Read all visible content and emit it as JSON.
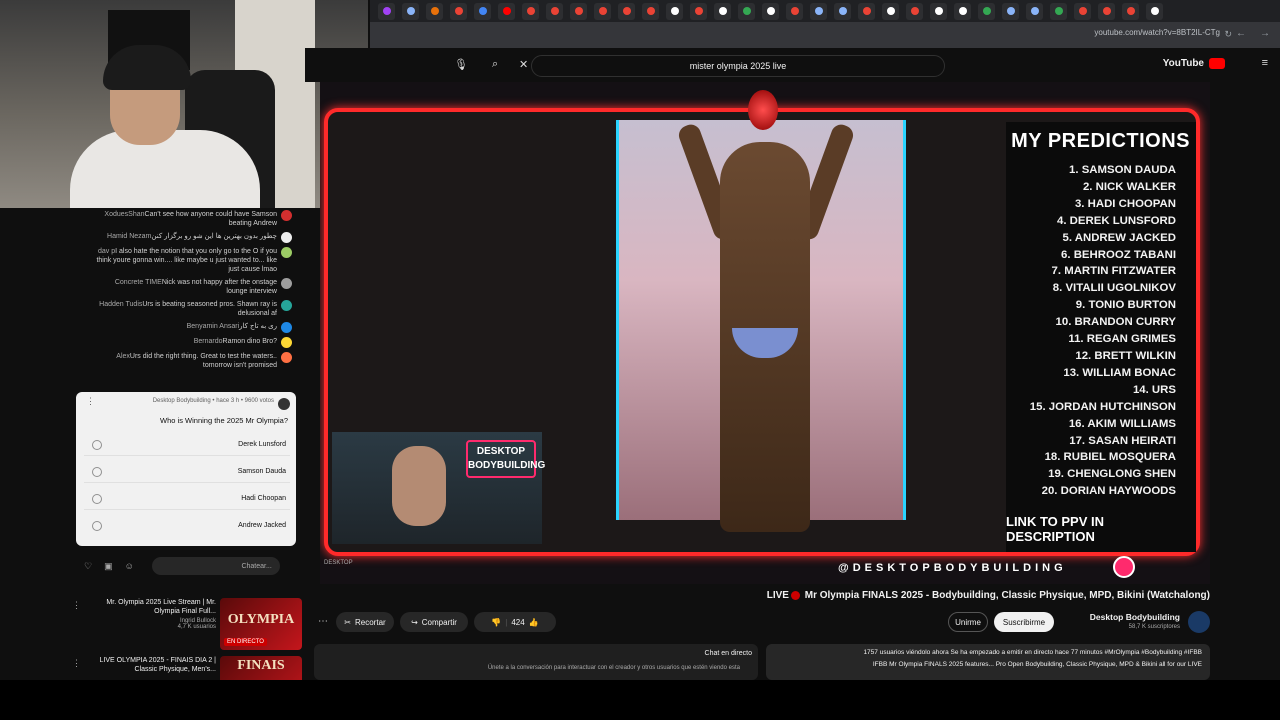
{
  "browser": {
    "url": "youtube.com/watch?v=8BT2IL-CTg",
    "tab_colors": [
      "#a142f4",
      "#8ab4f8",
      "#e8710a",
      "#ea4335",
      "#4285f4",
      "#ff0000",
      "#ea4335",
      "#ea4335",
      "#ea4335",
      "#ea4335",
      "#ea4335",
      "#ea4335",
      "#ffffff",
      "#ea4335",
      "#ffffff",
      "#34a853",
      "#ffffff",
      "#ea4335",
      "#8ab4f8",
      "#8ab4f8",
      "#ea4335",
      "#ffffff",
      "#ea4335",
      "#ffffff",
      "#ffffff",
      "#34a853",
      "#8ab4f8",
      "#8ab4f8",
      "#34a853",
      "#ea4335",
      "#ea4335",
      "#ea4335",
      "#ffffff"
    ]
  },
  "youtube": {
    "logo_text": "YouTube",
    "search_query": "mister olympia 2025 live"
  },
  "chat": {
    "messages": [
      {
        "author": "XoduesShan",
        "text": "Can't see how anyone could have Samson beating Andrew",
        "color": "#d32f2f"
      },
      {
        "author": "Hamid Nezam",
        "text": "چطور بدون بهترین ها این شو رو برگزار کنن",
        "color": "#eeeeee"
      },
      {
        "author": "dav p",
        "text": "I also hate the notion that you only go to the O if you think youre gonna win.... like maybe u just wanted to... like just cause lmao",
        "color": "#9ccc65"
      },
      {
        "author": "Concrete TIME",
        "text": "Nick was not happy after the onstage lounge interview",
        "color": "#9e9e9e"
      },
      {
        "author": "Hadden Tudis",
        "text": "Urs is beating seasoned pros. Shawn ray is delusional af",
        "color": "#26a69a"
      },
      {
        "author": "Benyamin Ansari",
        "text": "ری به تاج کار",
        "color": "#1e88e5"
      },
      {
        "author": "Bernardo",
        "text": "Ramon dino Bro?",
        "color": "#fdd835"
      },
      {
        "author": "Alex",
        "text": "Urs did the right thing. Great to test the waters.. tomorrow isn't promised",
        "color": "#ff7043"
      }
    ],
    "poll": {
      "meta": "Desktop Bodybuilding • hace 3 h • 9600 votos",
      "question": "Who is Winning the 2025 Mr Olympia?",
      "options": [
        "Derek Lunsford",
        "Samson Dauda",
        "Hadi Choopan",
        "Andrew Jacked"
      ]
    },
    "input_placeholder": "Chatear..."
  },
  "related": [
    {
      "title": "Mr. Olympia 2025 Live Stream | Mr. Olympia Final Full...",
      "channel": "Ingrid Bullock",
      "views": "4,7 K usuarios",
      "thumb_text": "OLYMPIA",
      "badge": "EN DIRECTO"
    },
    {
      "title": "LIVE OLYMPIA 2025 - FINAIS DIA 2 | Classic Physique, Men's...",
      "channel": "",
      "views": "",
      "thumb_text": "FINAIS",
      "badge": ""
    }
  ],
  "video": {
    "predictions_title": "MY PREDICTIONS",
    "predictions": [
      "1. SAMSON DAUDA",
      "2. NICK WALKER",
      "3. HADI CHOOPAN",
      "4. DEREK LUNSFORD",
      "5. ANDREW JACKED",
      "6. BEHROOZ TABANI",
      "7. MARTIN FITZWATER",
      "8. VITALII UGOLNIKOV",
      "9. TONIO BURTON",
      "10. BRANDON CURRY",
      "11. REGAN GRIMES",
      "12. BRETT WILKIN",
      "13. WILLIAM BONAC",
      "14. URS",
      "15. JORDAN HUTCHINSON",
      "16. AKIM WILLIAMS",
      "17. SASAN HEIRATI",
      "18. RUBIEL MOSQUERA",
      "19. CHENGLONG SHEN",
      "20. DORIAN HAYWOODS"
    ],
    "link_text": "LINK TO PPV IN DESCRIPTION",
    "handle": "@DESKTOPBODYBUILDING",
    "logo_lines": [
      "DESKTOP",
      "BODYBUILDING"
    ],
    "corner_tag": "DESKTOP"
  },
  "title": {
    "live": "LIVE",
    "text": "Mr Olympia FINALS 2025 - Bodybuilding, Classic Physique, MPD, Bikini (Watchalong)"
  },
  "actions": {
    "likes": "424",
    "share": "Compartir",
    "clip": "Recortar",
    "channel": "Desktop Bodybuilding",
    "subscribers": "58,7 K suscriptores",
    "join": "Unirme",
    "subscribe": "Suscribirme"
  },
  "chat_panel": {
    "heading": "Chat en directo",
    "sub": "Únete a la conversación para interactuar con el creador y otros usuarios que estén viendo esta"
  },
  "description": {
    "line1": "1757 usuarios viéndolo ahora  Se ha empezado a emitir en directo hace 77 minutos  #MrOlympia #Bodybuilding #IFBB",
    "line2": "IFBB Mr Olympia FINALS 2025 features... Pro Open Bodybuilding, Classic Physique, MPD & Bikini all for our LIVE"
  }
}
